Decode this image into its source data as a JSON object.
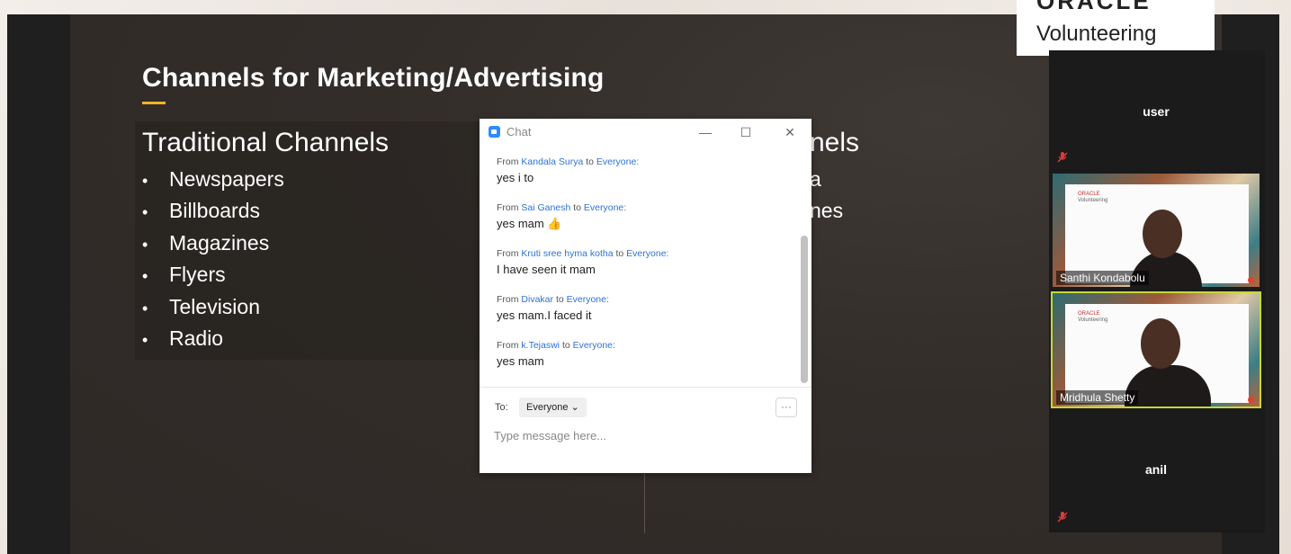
{
  "slide": {
    "title": "Channels for Marketing/Advertising",
    "left_column": {
      "heading": "Traditional Channels",
      "items": [
        "Newspapers",
        "Billboards",
        "Magazines",
        "Flyers",
        "Television",
        "Radio"
      ]
    },
    "right_column": {
      "heading_visible": "nels",
      "items_visible": [
        "a",
        "nes"
      ]
    },
    "bullet": "•"
  },
  "logo": {
    "top_word": "ORACLE",
    "sub_word": "Volunteering"
  },
  "participants": [
    {
      "name": "user",
      "type": "avatar",
      "muted": true
    },
    {
      "name": "Santhi Kondabolu",
      "type": "video",
      "muted": true
    },
    {
      "name": "Mridhula Shetty",
      "type": "video",
      "muted": true,
      "active_speaker": true
    },
    {
      "name": "anil",
      "type": "avatar",
      "muted": true
    }
  ],
  "video_board": {
    "logo": "ORACLE",
    "sub": "Volunteering"
  },
  "chat": {
    "title": "Chat",
    "window_buttons": {
      "minimize": "—",
      "maximize": "☐",
      "close": "✕"
    },
    "messages": [
      {
        "from_label": "From",
        "sender": "Kandala Surya",
        "to_label": "to",
        "recipient": "Everyone:",
        "text": "yes i to"
      },
      {
        "from_label": "From",
        "sender": "Sai Ganesh",
        "to_label": "to",
        "recipient": "Everyone:",
        "text": "yes mam 👍"
      },
      {
        "from_label": "From",
        "sender": "Kruti sree hyma kotha",
        "to_label": "to",
        "recipient": "Everyone:",
        "text": "I have seen it mam"
      },
      {
        "from_label": "From",
        "sender": "Divakar",
        "to_label": "to",
        "recipient": "Everyone:",
        "text": "yes mam.I faced it"
      },
      {
        "from_label": "From",
        "sender": "k.Tejaswi",
        "to_label": "to",
        "recipient": "Everyone:",
        "text": "yes mam"
      }
    ],
    "to_label": "To:",
    "recipient_select": "Everyone ⌄",
    "more_button": "···",
    "input_placeholder": "Type message here..."
  },
  "colors": {
    "slide_bg": "#332d2a",
    "accent_underline": "#f0b429",
    "chat_link": "#2d72d9",
    "active_speaker_border": "#c6d833"
  }
}
